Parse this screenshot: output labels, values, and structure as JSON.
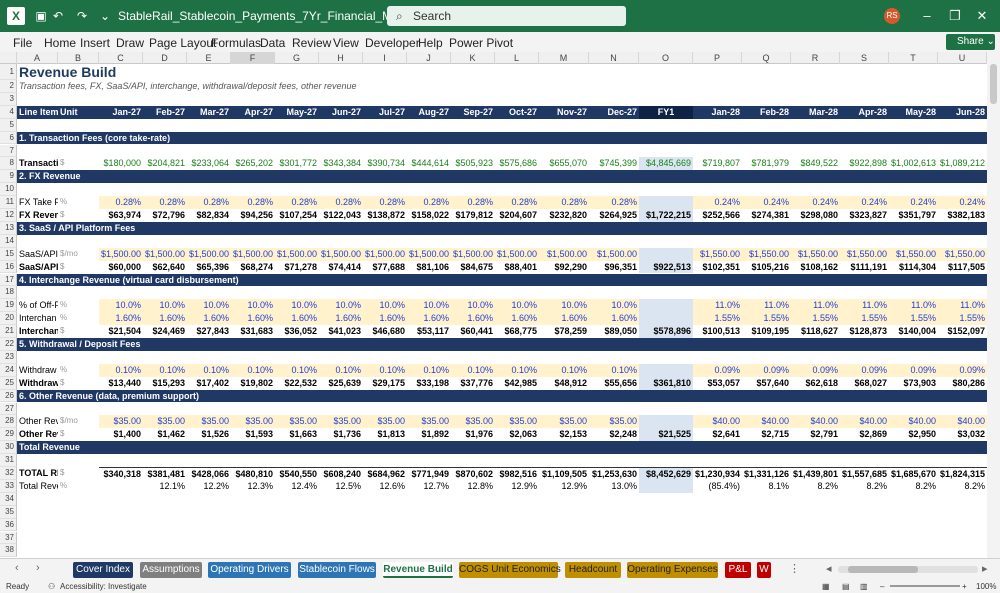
{
  "window": {
    "title": "StableRail_Stablecoin_Payments_7Yr_Financial_Model.xlsx  -  Excel",
    "search_placeholder": "Search",
    "avatar": "RS"
  },
  "menu": [
    "File",
    "Home",
    "Insert",
    "Draw",
    "Page Layout",
    "Formulas",
    "Data",
    "Review",
    "View",
    "Developer",
    "Help",
    "Power Pivot"
  ],
  "share_label": "Share",
  "columns": [
    "A",
    "B",
    "C",
    "D",
    "E",
    "F",
    "G",
    "H",
    "I",
    "J",
    "K",
    "L",
    "M",
    "N",
    "O",
    "P",
    "Q",
    "R",
    "S",
    "T",
    "U"
  ],
  "sheet": {
    "title": "Revenue Build",
    "subtitle": "Transaction fees, FX, SaaS/API, interchange, withdrawal/deposit fees, other revenue",
    "header": {
      "line_item": "Line Item",
      "unit": "Unit",
      "months": [
        "Jan-27",
        "Feb-27",
        "Mar-27",
        "Apr-27",
        "May-27",
        "Jun-27",
        "Jul-27",
        "Aug-27",
        "Sep-27",
        "Oct-27",
        "Nov-27",
        "Dec-27",
        "FY1",
        "Jan-28",
        "Feb-28",
        "Mar-28",
        "Apr-28",
        "May-28",
        "Jun-28"
      ]
    },
    "sections": {
      "s1": "1. Transaction Fees (core take-rate)",
      "s2": "2. FX Revenue",
      "s3": "3. SaaS / API Platform Fees",
      "s4": "4. Interchange Revenue (virtual card disbursement)",
      "s5": "5. Withdrawal / Deposit Fees",
      "s6": "6. Other Revenue (data, premium support)",
      "s7": "Total Revenue"
    },
    "rows": {
      "r8": {
        "label": "Transacti",
        "unit": "$",
        "values": [
          "$180,000",
          "$204,821",
          "$233,064",
          "$265,202",
          "$301,772",
          "$343,384",
          "$390,734",
          "$444,614",
          "$505,923",
          "$575,686",
          "$655,070",
          "$745,399",
          "$4,845,669",
          "$719,807",
          "$781,979",
          "$849,522",
          "$922,898",
          "$1,002,613",
          "$1,089,212"
        ]
      },
      "r11": {
        "label": "FX Take F",
        "unit": "%",
        "values": [
          "0.28%",
          "0.28%",
          "0.28%",
          "0.28%",
          "0.28%",
          "0.28%",
          "0.28%",
          "0.28%",
          "0.28%",
          "0.28%",
          "0.28%",
          "0.28%",
          "",
          "0.24%",
          "0.24%",
          "0.24%",
          "0.24%",
          "0.24%",
          "0.24%"
        ]
      },
      "r12": {
        "label": "FX Reven",
        "unit": "$",
        "values": [
          "$63,974",
          "$72,796",
          "$82,834",
          "$94,256",
          "$107,254",
          "$122,043",
          "$138,872",
          "$158,022",
          "$179,812",
          "$204,607",
          "$232,820",
          "$264,925",
          "$1,722,215",
          "$252,566",
          "$274,381",
          "$298,080",
          "$323,827",
          "$351,797",
          "$382,183"
        ]
      },
      "r15": {
        "label": "SaaS/API",
        "unit": "$/mo",
        "values": [
          "$1,500.00",
          "$1,500.00",
          "$1,500.00",
          "$1,500.00",
          "$1,500.00",
          "$1,500.00",
          "$1,500.00",
          "$1,500.00",
          "$1,500.00",
          "$1,500.00",
          "$1,500.00",
          "$1,500.00",
          "",
          "$1,550.00",
          "$1,550.00",
          "$1,550.00",
          "$1,550.00",
          "$1,550.00",
          "$1,550.00"
        ]
      },
      "r16": {
        "label": "SaaS/API",
        "unit": "$",
        "values": [
          "$60,000",
          "$62,640",
          "$65,396",
          "$68,274",
          "$71,278",
          "$74,414",
          "$77,688",
          "$81,106",
          "$84,675",
          "$88,401",
          "$92,290",
          "$96,351",
          "$922,513",
          "$102,351",
          "$105,216",
          "$108,162",
          "$111,191",
          "$114,304",
          "$117,505"
        ]
      },
      "r19": {
        "label": "% of Off-F",
        "unit": "%",
        "values": [
          "10.0%",
          "10.0%",
          "10.0%",
          "10.0%",
          "10.0%",
          "10.0%",
          "10.0%",
          "10.0%",
          "10.0%",
          "10.0%",
          "10.0%",
          "10.0%",
          "",
          "11.0%",
          "11.0%",
          "11.0%",
          "11.0%",
          "11.0%",
          "11.0%"
        ]
      },
      "r20": {
        "label": "Interchan",
        "unit": "%",
        "values": [
          "1.60%",
          "1.60%",
          "1.60%",
          "1.60%",
          "1.60%",
          "1.60%",
          "1.60%",
          "1.60%",
          "1.60%",
          "1.60%",
          "1.60%",
          "1.60%",
          "",
          "1.55%",
          "1.55%",
          "1.55%",
          "1.55%",
          "1.55%",
          "1.55%"
        ]
      },
      "r21": {
        "label": "Interchan",
        "unit": "$",
        "values": [
          "$21,504",
          "$24,469",
          "$27,843",
          "$31,683",
          "$36,052",
          "$41,023",
          "$46,680",
          "$53,117",
          "$60,441",
          "$68,775",
          "$78,259",
          "$89,050",
          "$578,896",
          "$100,513",
          "$109,195",
          "$118,627",
          "$128,873",
          "$140,004",
          "$152,097"
        ]
      },
      "r24": {
        "label": "Withdraw",
        "unit": "%",
        "values": [
          "0.10%",
          "0.10%",
          "0.10%",
          "0.10%",
          "0.10%",
          "0.10%",
          "0.10%",
          "0.10%",
          "0.10%",
          "0.10%",
          "0.10%",
          "0.10%",
          "",
          "0.09%",
          "0.09%",
          "0.09%",
          "0.09%",
          "0.09%",
          "0.09%"
        ]
      },
      "r25": {
        "label": "Withdraw",
        "unit": "$",
        "values": [
          "$13,440",
          "$15,293",
          "$17,402",
          "$19,802",
          "$22,532",
          "$25,639",
          "$29,175",
          "$33,198",
          "$37,776",
          "$42,985",
          "$48,912",
          "$55,656",
          "$361,810",
          "$53,057",
          "$57,640",
          "$62,618",
          "$68,027",
          "$73,903",
          "$80,286"
        ]
      },
      "r28": {
        "label": "Other Rev",
        "unit": "$/mo",
        "values": [
          "$35.00",
          "$35.00",
          "$35.00",
          "$35.00",
          "$35.00",
          "$35.00",
          "$35.00",
          "$35.00",
          "$35.00",
          "$35.00",
          "$35.00",
          "$35.00",
          "",
          "$40.00",
          "$40.00",
          "$40.00",
          "$40.00",
          "$40.00",
          "$40.00"
        ]
      },
      "r29": {
        "label": "Other Rev",
        "unit": "$",
        "values": [
          "$1,400",
          "$1,462",
          "$1,526",
          "$1,593",
          "$1,663",
          "$1,736",
          "$1,813",
          "$1,892",
          "$1,976",
          "$2,063",
          "$2,153",
          "$2,248",
          "$21,525",
          "$2,641",
          "$2,715",
          "$2,791",
          "$2,869",
          "$2,950",
          "$3,032"
        ]
      },
      "r32": {
        "label": "TOTAL RI",
        "unit": "$",
        "values": [
          "$340,318",
          "$381,481",
          "$428,066",
          "$480,810",
          "$540,550",
          "$608,240",
          "$684,962",
          "$771,949",
          "$870,602",
          "$982,516",
          "$1,109,505",
          "$1,253,630",
          "$8,452,629",
          "$1,230,934",
          "$1,331,126",
          "$1,439,801",
          "$1,557,685",
          "$1,685,670",
          "$1,824,315"
        ]
      },
      "r33": {
        "label": "Total Reve",
        "unit": "%",
        "values": [
          "",
          "12.1%",
          "12.2%",
          "12.3%",
          "12.4%",
          "12.5%",
          "12.6%",
          "12.7%",
          "12.8%",
          "12.9%",
          "12.9%",
          "13.0%",
          "",
          "(85.4%)",
          "8.1%",
          "8.2%",
          "8.2%",
          "8.2%",
          "8.2%"
        ]
      }
    }
  },
  "tabs": [
    {
      "label": "Cover Index",
      "color": "#1f3864"
    },
    {
      "label": "Assumptions",
      "color": "#7f7f7f"
    },
    {
      "label": "Operating Drivers",
      "color": "#2e75b6"
    },
    {
      "label": "Stablecoin Flows",
      "color": "#2e75b6"
    },
    {
      "label": "Revenue Build",
      "color": "#ffffff",
      "active": true
    },
    {
      "label": "COGS Unit Economics",
      "color": "#bf8f00"
    },
    {
      "label": "Headcount",
      "color": "#bf8f00"
    },
    {
      "label": "Operating Expenses",
      "color": "#bf8f00"
    },
    {
      "label": "P&L",
      "color": "#c00000"
    },
    {
      "label": "W",
      "color": "#c00000"
    }
  ],
  "status": {
    "ready": "Ready",
    "accessibility": "Accessibility: Investigate",
    "zoom": "100%"
  }
}
